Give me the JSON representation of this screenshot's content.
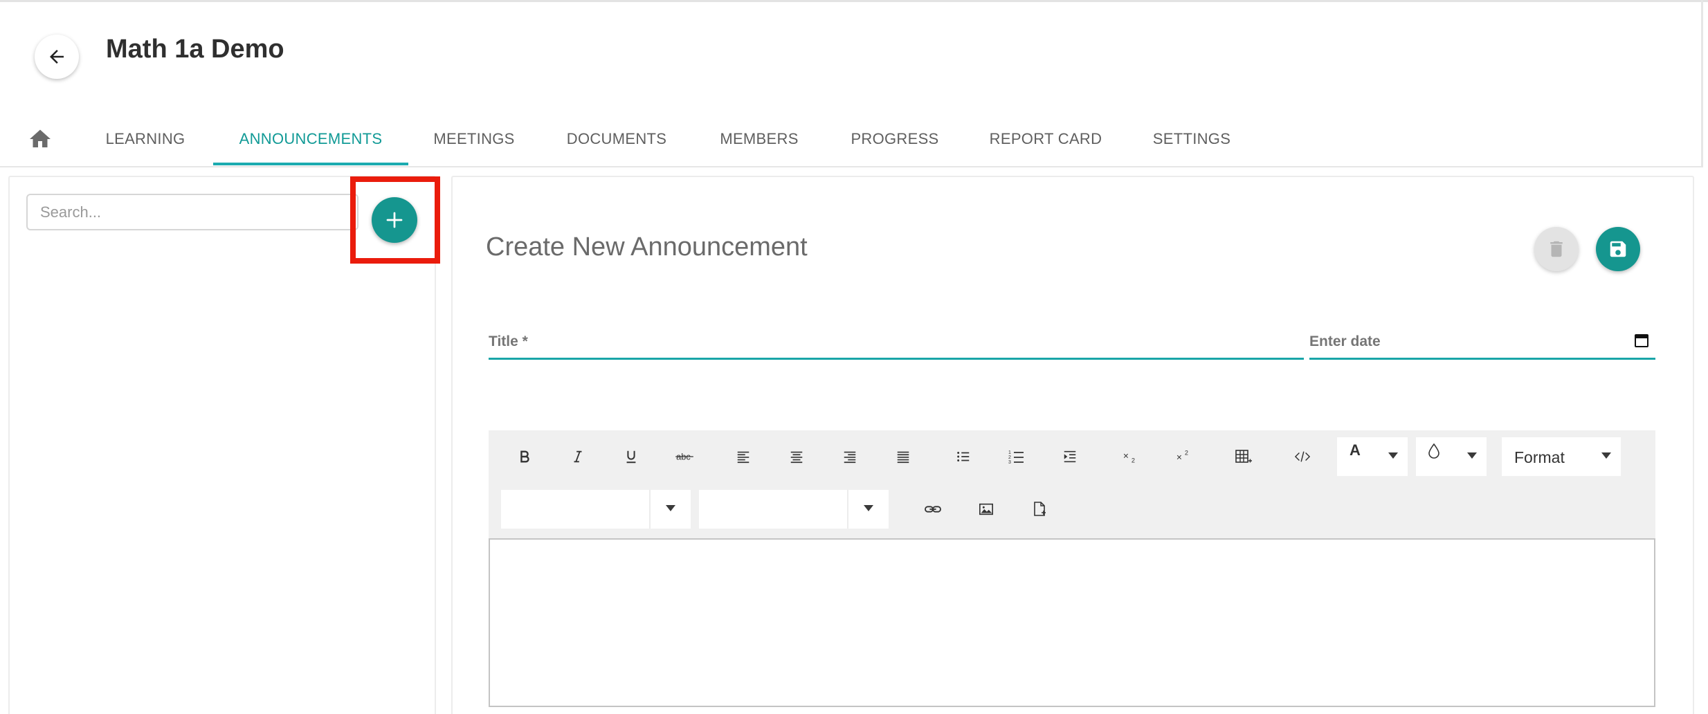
{
  "header": {
    "title": "Math 1a Demo"
  },
  "tabs": [
    {
      "label": "LEARNING"
    },
    {
      "label": "ANNOUNCEMENTS"
    },
    {
      "label": "MEETINGS"
    },
    {
      "label": "DOCUMENTS"
    },
    {
      "label": "MEMBERS"
    },
    {
      "label": "PROGRESS"
    },
    {
      "label": "REPORT CARD"
    },
    {
      "label": "SETTINGS"
    }
  ],
  "active_tab": "ANNOUNCEMENTS",
  "left_panel": {
    "search": {
      "placeholder": "Search...",
      "value": ""
    }
  },
  "form": {
    "heading": "Create New Announcement",
    "title_field": {
      "label": "Title *",
      "value": ""
    },
    "date_field": {
      "label": "Enter date",
      "value": ""
    }
  },
  "editor": {
    "format_label": "Format",
    "text_color_letter": "A",
    "content": ""
  },
  "icons": {
    "back": "arrow-left-icon",
    "home": "home-icon",
    "add": "plus-icon",
    "delete": "trash-icon",
    "save": "floppy-disk-icon",
    "calendar": "calendar-icon"
  },
  "colors": {
    "accent": "#15968f",
    "active_tab_text": "#119a96",
    "tab_underline": "#1cabb0",
    "highlight": "#ea1c0c"
  }
}
